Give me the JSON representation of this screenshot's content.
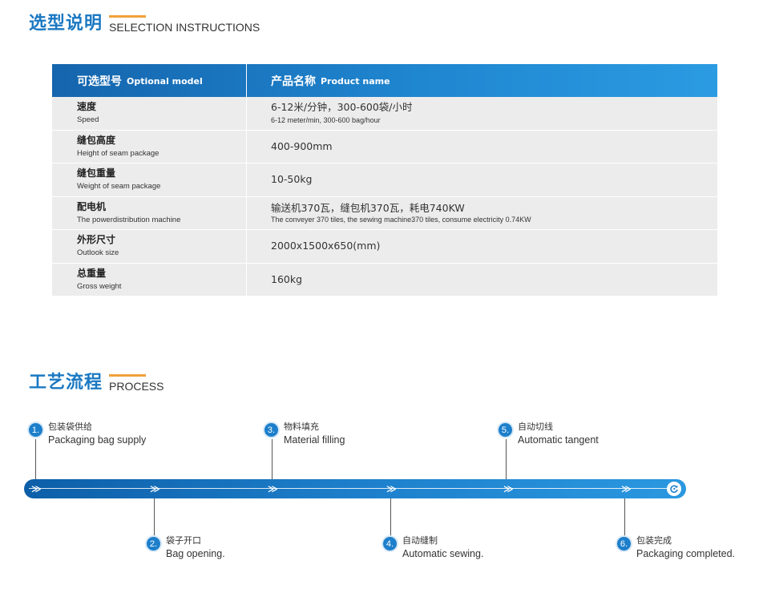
{
  "selection": {
    "title_cn": "选型说明",
    "title_en": "SELECTION INSTRUCTIONS"
  },
  "table": {
    "header": {
      "col1_cn": "可选型号",
      "col1_en": "Optional model",
      "col2_cn": "产品名称",
      "col2_en": "Product name"
    },
    "rows": [
      {
        "label_cn": "速度",
        "label_en": "Speed",
        "value": "6-12米/分钟，300-600袋/小时",
        "value_en": "6-12 meter/min, 300-600 bag/hour"
      },
      {
        "label_cn": "缝包高度",
        "label_en": "Height of seam package",
        "value": "400-900mm",
        "value_en": ""
      },
      {
        "label_cn": "缝包重量",
        "label_en": "Weight of seam package",
        "value": "10-50kg",
        "value_en": ""
      },
      {
        "label_cn": "配电机",
        "label_en": "The powerdistribution machine",
        "value": "输送机370瓦，缝包机370瓦，耗电740KW",
        "value_en": "The conveyer 370 tiles, the sewing machine370 tiles, consume electricity 0.74KW"
      },
      {
        "label_cn": "外形尺寸",
        "label_en": "Outlook size",
        "value": "2000x1500x650(mm)",
        "value_en": ""
      },
      {
        "label_cn": "总重量",
        "label_en": "Gross weight",
        "value": "160kg",
        "value_en": ""
      }
    ]
  },
  "process": {
    "title_cn": "工艺流程",
    "title_en": "PROCESS",
    "steps": [
      {
        "num": "1.",
        "cn": "包装袋供给",
        "en": "Packaging bag supply"
      },
      {
        "num": "2.",
        "cn": "袋子开口",
        "en": "Bag opening."
      },
      {
        "num": "3.",
        "cn": "物料填充",
        "en": "Material filling"
      },
      {
        "num": "4.",
        "cn": "自动缝制",
        "en": "Automatic sewing."
      },
      {
        "num": "5.",
        "cn": "自动切线",
        "en": "Automatic tangent"
      },
      {
        "num": "6.",
        "cn": "包装完成",
        "en": "Packaging completed."
      }
    ],
    "arrow_glyph": "≫",
    "loop_icon": "refresh-icon"
  },
  "colors": {
    "accent_blue": "#1a78c2",
    "accent_orange": "#f0a23a",
    "row_bg": "#ececec"
  }
}
